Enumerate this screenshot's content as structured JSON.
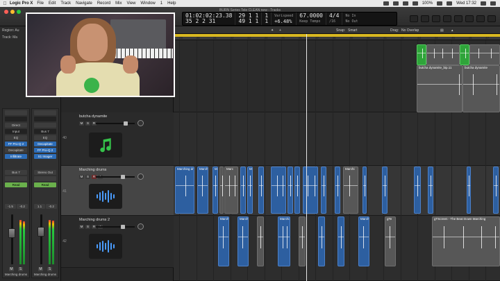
{
  "menubar": {
    "app_name": "Logic Pro X",
    "items": [
      "File",
      "Edit",
      "Track",
      "Navigate",
      "Record",
      "Mix",
      "View",
      "Window",
      "1",
      "Help"
    ],
    "battery": "100%",
    "clock": "Wed 17:32"
  },
  "window": {
    "title": "BURN Series Tele CLEAN new - Tracks"
  },
  "lcd": {
    "time_top": "01:02:02:23.38",
    "time_bottom": "35  2  2   31",
    "bars_top": "29  1  1",
    "bars_bottom": "49  1  1",
    "bars_small_top": "1",
    "bars_small_bottom": "1",
    "varispeed_label": "Varispeed",
    "varispeed_value": "+6.48%",
    "tempo": "67.0000",
    "tempo_mode": "Keep Tempo",
    "sig_top": "4/4",
    "sig_bottom": "/16",
    "in_label": "No In",
    "out_label": "No Out"
  },
  "inspector": {
    "region_label": "Region:",
    "region_value": "Au",
    "track_label": "Track:",
    "track_value": "Ma",
    "strip1": {
      "slots": [
        "Direct",
        "",
        "FF Pro-Q 2",
        "Decapitate",
        "Infiltrate"
      ],
      "eq_label": "EQ",
      "input_label": "Input",
      "bus_label": "Bus 7",
      "read_label": "Read",
      "vol": "-1.5",
      "peak": "-0.2",
      "name": "Marching drums"
    },
    "strip2": {
      "slots": [
        "",
        "",
        "Bus 7",
        "Decapitate",
        "FF Pro-Q 2",
        "S1 Imager"
      ],
      "eq_label": "EQ",
      "output_label": "Stereo Out",
      "read_label": "Read",
      "vol": "1.1",
      "peak": "-0.2",
      "name": "Marching drums"
    }
  },
  "tracks": [
    {
      "num": "",
      "name": "",
      "type": "midi"
    },
    {
      "num": "40",
      "name": "butcha dynamite",
      "type": "midi"
    },
    {
      "num": "41",
      "name": "Marching drums",
      "type": "audio"
    },
    {
      "num": "42",
      "name": "Marching drums 2",
      "type": "audio"
    }
  ],
  "track_buttons": {
    "mute": "M",
    "solo": "S",
    "record": "R",
    "input": "I"
  },
  "arrange_toolbar": {
    "snap_label": "Snap:",
    "snap_value": "Smart",
    "drag_label": "Drag:",
    "drag_value": "No Overlap"
  },
  "ruler_ticks": [
    "29",
    "30",
    "31",
    "32",
    "33",
    "34",
    "35",
    "36",
    "37",
    "38",
    "39",
    "40",
    "41",
    "42",
    "43",
    "44",
    "45",
    "46",
    "47"
  ],
  "regions": {
    "lane1": [
      "butcha dynamite_bip.11",
      "butcha dynamite"
    ],
    "lane2": [
      "Marching dr",
      "Marchi",
      "Ma",
      "M",
      "Marc",
      "Marchi"
    ],
    "lane3": [
      "Marchi",
      "Marchi",
      "Marchi",
      "Marchi",
      "gTe",
      "gTScreen - The Beat Down Marching"
    ]
  },
  "colors": {
    "cycle": "#d9b820",
    "audio_region": "#2d5fa0",
    "midi_region": "#2fa43a",
    "selected_track": "#454545"
  }
}
